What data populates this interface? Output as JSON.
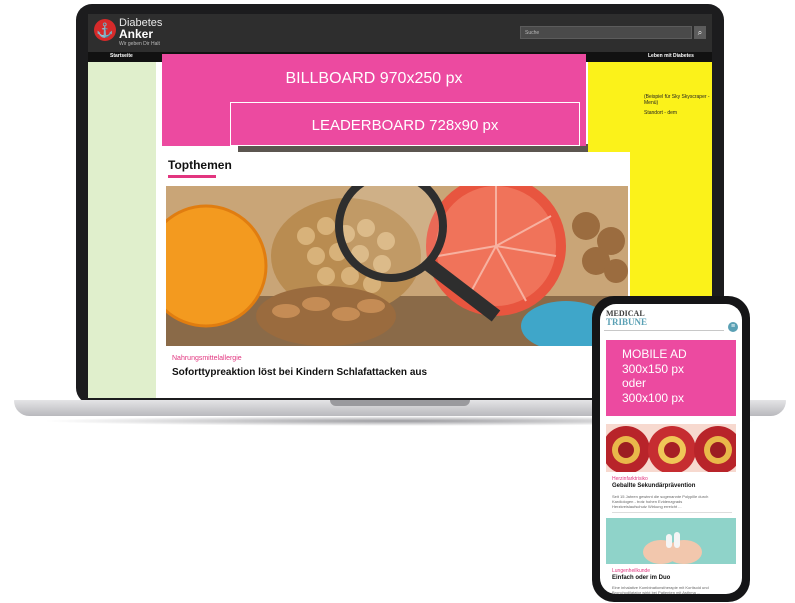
{
  "laptop_site": {
    "logo": {
      "line1": "Diabetes",
      "line2": "Anker",
      "tagline": "Wir geben Dir Halt",
      "icon": "anchor-icon"
    },
    "search_placeholder": "Suche",
    "search_icon": "search-icon",
    "nav": {
      "start": "Startseite",
      "leben": "Leben mit Diabetes"
    },
    "ad_fragments": [
      "(Beispiel für Sky Skyscraper - Menü)",
      "Standort - dem"
    ],
    "billboard_label": "BILLBOARD 970x250 px",
    "leaderboard_label": "LEADERBOARD 728x90 px",
    "section_heading": "Topthemen",
    "article": {
      "kicker": "Nahrungsmittelallergie",
      "title": "Soforttypreaktion löst bei Kindern Schlafattacken aus"
    }
  },
  "phone_site": {
    "logo_line1": "MEDICAL",
    "logo_line2": "TRIBUNE",
    "menu_icon": "menu-icon",
    "mobile_ad_lines": [
      "MOBILE AD",
      "300x150 px",
      "oder",
      "300x100 px"
    ],
    "articles": [
      {
        "kicker": "Herzinfarktrisiko",
        "title": "Geballte Sekundärprävention",
        "body": [
          "Seit 15 Jahren gewinnt die sogenannte Polypille durch",
          "Kardiologen - trotz hohen Evidenzgrads",
          "Herzkreislaufschutz Wirkung erreicht ..."
        ]
      },
      {
        "kicker": "Lungenheilkunde",
        "title": "Einfach oder im Duo",
        "body": [
          "Eine inhalative Kombinationstherapie mit Kortisoid und",
          "Bronchodilatator wirkt bei Patienten mit Asthma ..."
        ]
      }
    ]
  },
  "colors": {
    "ad_pink": "#ec4aa0",
    "accent_pink": "#e2357f",
    "skyscraper_yellow": "#fbf21a",
    "side_green": "#e0efcc"
  }
}
